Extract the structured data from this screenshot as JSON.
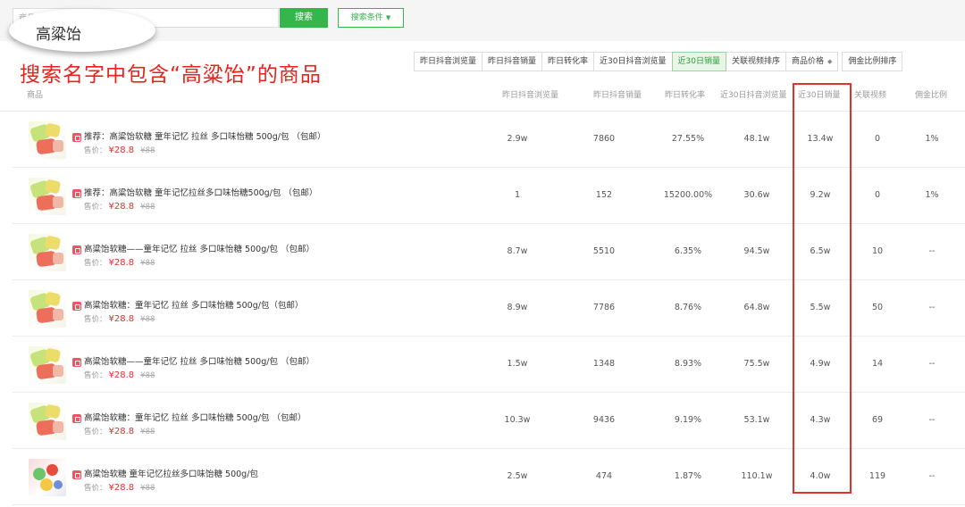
{
  "search": {
    "input_text": "商品",
    "button_label": "搜索",
    "condition_label": "搜索条件"
  },
  "callout": {
    "bubble_text": "高粱饴",
    "annotation": "搜索名字中包含“高粱饴”的商品"
  },
  "sort_buttons": [
    {
      "label": "昨日抖音浏览量",
      "active": false
    },
    {
      "label": "昨日抖音销量",
      "active": false
    },
    {
      "label": "昨日转化率",
      "active": false
    },
    {
      "label": "近30日抖音浏览量",
      "active": false
    },
    {
      "label": "近30日销量",
      "active": true
    },
    {
      "label": "关联视频排序",
      "active": false
    },
    {
      "label": "商品价格",
      "active": false,
      "has_sort_icon": true
    },
    {
      "label": "佣金比例排序",
      "active": false
    }
  ],
  "table": {
    "headers": [
      "商品",
      "昨日抖音浏览量",
      "昨日抖音销量",
      "昨日转化率",
      "近30日抖音浏览量",
      "近30日销量",
      "关联视频",
      "佣金比例"
    ],
    "price_label": "售价：",
    "rows": [
      {
        "title": "推荐：高粱饴软糖 童年记忆 拉丝 多口味怡糖 500g/包 （包邮）",
        "price": "¥28.8",
        "old_price": "¥88",
        "views": "2.9w",
        "sales": "7860",
        "conversion": "27.55%",
        "views30": "48.1w",
        "sales30": "13.4w",
        "videos": "0",
        "commission": "1%",
        "thumb": "candy"
      },
      {
        "title": "推荐：高粱饴软糖 童年记忆拉丝多口味怡糖500g/包 （包邮）",
        "price": "¥28.8",
        "old_price": "¥88",
        "views": "1",
        "sales": "152",
        "conversion": "15200.00%",
        "views30": "30.6w",
        "sales30": "9.2w",
        "videos": "0",
        "commission": "1%",
        "thumb": "candy"
      },
      {
        "title": "高粱饴软糖——童年记忆 拉丝 多口味怡糖 500g/包 （包邮）",
        "price": "¥28.8",
        "old_price": "¥88",
        "views": "8.7w",
        "sales": "5510",
        "conversion": "6.35%",
        "views30": "94.5w",
        "sales30": "6.5w",
        "videos": "10",
        "commission": "--",
        "thumb": "candy"
      },
      {
        "title": "高粱饴软糖：童年记忆 拉丝 多口味怡糖 500g/包（包邮）",
        "price": "¥28.8",
        "old_price": "¥88",
        "views": "8.9w",
        "sales": "7786",
        "conversion": "8.76%",
        "views30": "64.8w",
        "sales30": "5.5w",
        "videos": "50",
        "commission": "--",
        "thumb": "candy"
      },
      {
        "title": "高粱饴软糖——童年记忆 拉丝 多口味怡糖 500g/包 （包邮）",
        "price": "¥28.8",
        "old_price": "¥88",
        "views": "1.5w",
        "sales": "1348",
        "conversion": "8.93%",
        "views30": "75.5w",
        "sales30": "4.9w",
        "videos": "14",
        "commission": "--",
        "thumb": "candy"
      },
      {
        "title": "高粱饴软糖：童年记忆 拉丝 多口味怡糖 500g/包 （包邮）",
        "price": "¥28.8",
        "old_price": "¥88",
        "views": "10.3w",
        "sales": "9436",
        "conversion": "9.19%",
        "views30": "53.1w",
        "sales30": "4.3w",
        "videos": "69",
        "commission": "--",
        "thumb": "candy"
      },
      {
        "title": "高粱饴软糖 童年记忆拉丝多口味饴糖 500g/包",
        "price": "¥28.8",
        "old_price": "¥88",
        "views": "2.5w",
        "sales": "474",
        "conversion": "1.87%",
        "views30": "110.1w",
        "sales30": "4.0w",
        "videos": "119",
        "commission": "--",
        "thumb": "candy-alt"
      }
    ]
  },
  "colors": {
    "accent_green": "#34b64a",
    "annotation_red": "#e8231c",
    "price_red": "#e2302f"
  }
}
